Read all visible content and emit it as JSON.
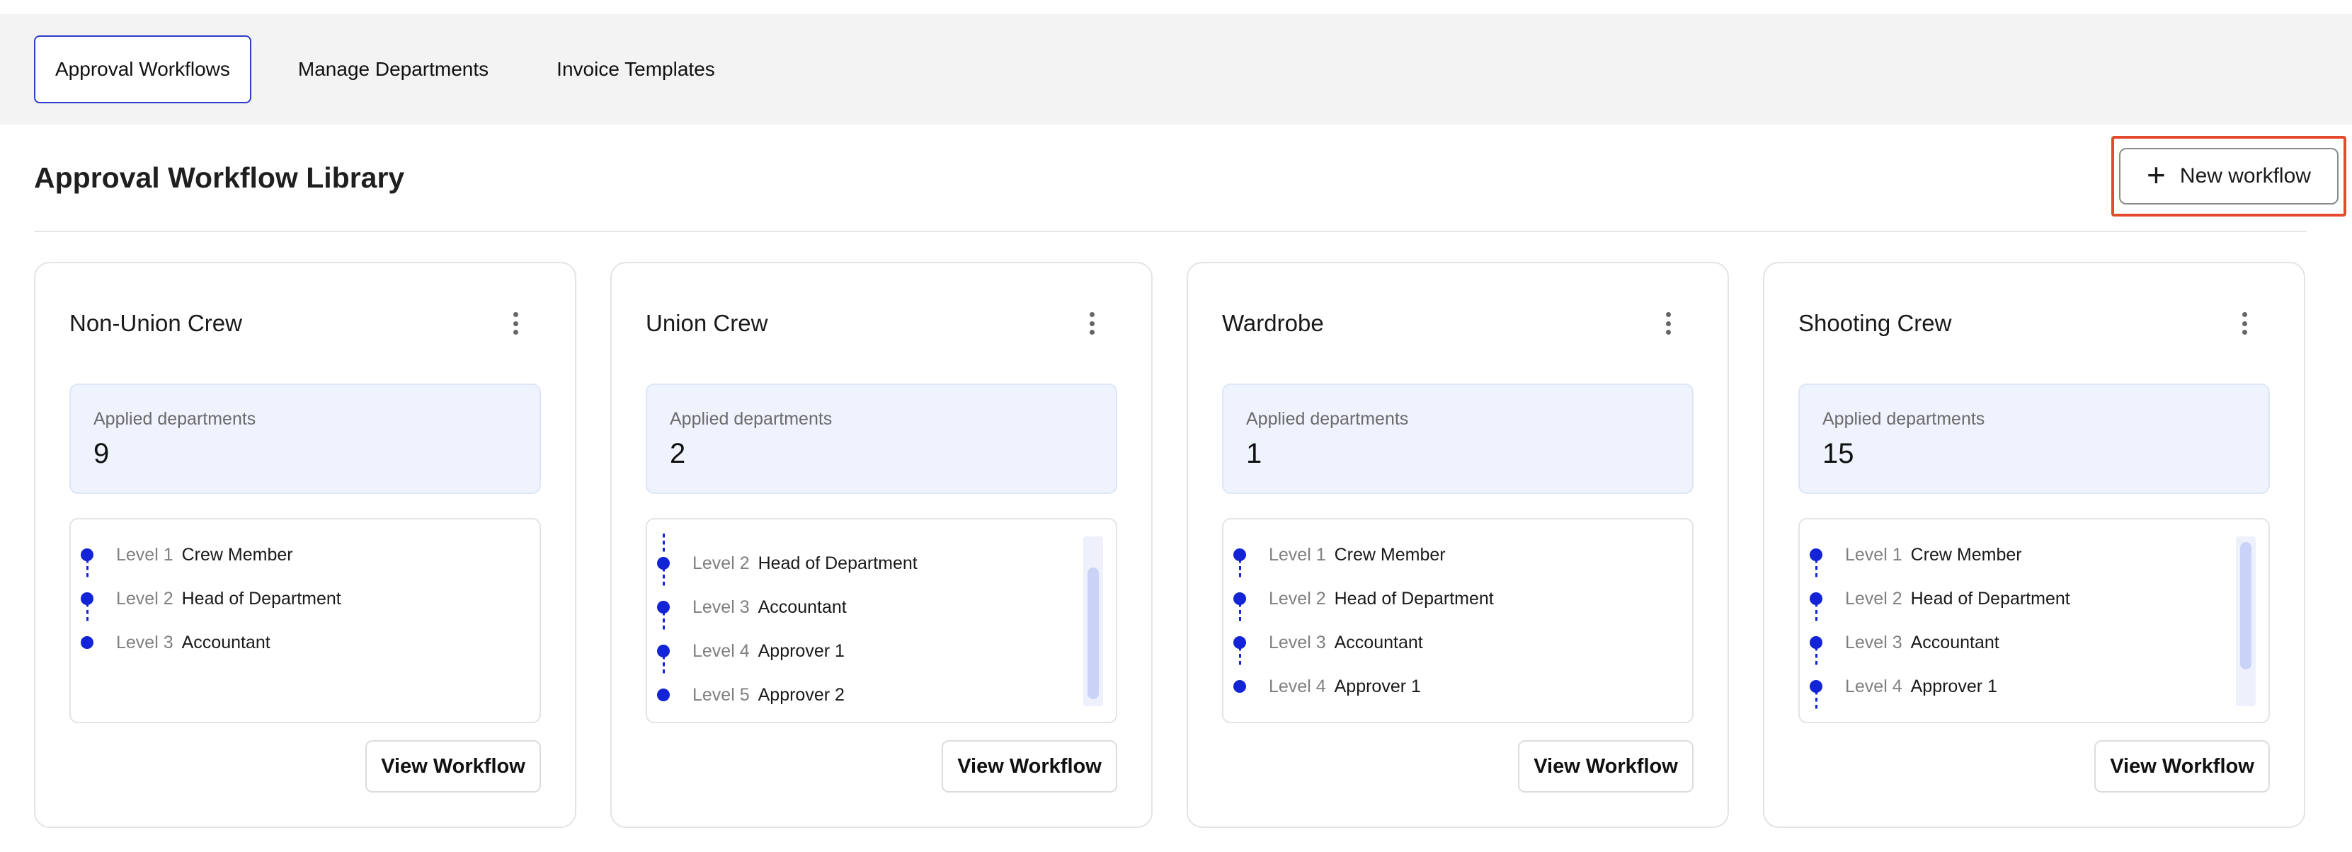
{
  "tabs": [
    {
      "label": "Approval Workflows",
      "active": true
    },
    {
      "label": "Manage Departments",
      "active": false
    },
    {
      "label": "Invoice Templates",
      "active": false
    }
  ],
  "header": {
    "title": "Approval Workflow Library",
    "new_button_label": "New workflow"
  },
  "cards": [
    {
      "title": "Non-Union Crew",
      "dept_label": "Applied departments",
      "dept_count": "9",
      "levels": [
        {
          "num": "Level 1",
          "name": "Crew Member"
        },
        {
          "num": "Level 2",
          "name": "Head of Department"
        },
        {
          "num": "Level 3",
          "name": "Accountant"
        }
      ],
      "view_label": "View Workflow"
    },
    {
      "title": "Union Crew",
      "dept_label": "Applied departments",
      "dept_count": "2",
      "levels": [
        {
          "num": "Level 2",
          "name": "Head of Department"
        },
        {
          "num": "Level 3",
          "name": "Accountant"
        },
        {
          "num": "Level 4",
          "name": "Approver 1"
        },
        {
          "num": "Level 5",
          "name": "Approver 2"
        }
      ],
      "view_label": "View Workflow"
    },
    {
      "title": "Wardrobe",
      "dept_label": "Applied departments",
      "dept_count": "1",
      "levels": [
        {
          "num": "Level 1",
          "name": "Crew Member"
        },
        {
          "num": "Level 2",
          "name": "Head of Department"
        },
        {
          "num": "Level 3",
          "name": "Accountant"
        },
        {
          "num": "Level 4",
          "name": "Approver 1"
        }
      ],
      "view_label": "View Workflow"
    },
    {
      "title": "Shooting Crew",
      "dept_label": "Applied departments",
      "dept_count": "15",
      "levels": [
        {
          "num": "Level 1",
          "name": "Crew Member"
        },
        {
          "num": "Level 2",
          "name": "Head of Department"
        },
        {
          "num": "Level 3",
          "name": "Accountant"
        },
        {
          "num": "Level 4",
          "name": "Approver 1"
        }
      ],
      "view_label": "View Workflow"
    }
  ],
  "colors": {
    "accent": "#1323d6",
    "tab_active_border": "#2b3fc9",
    "highlight": "#e64a2e"
  }
}
